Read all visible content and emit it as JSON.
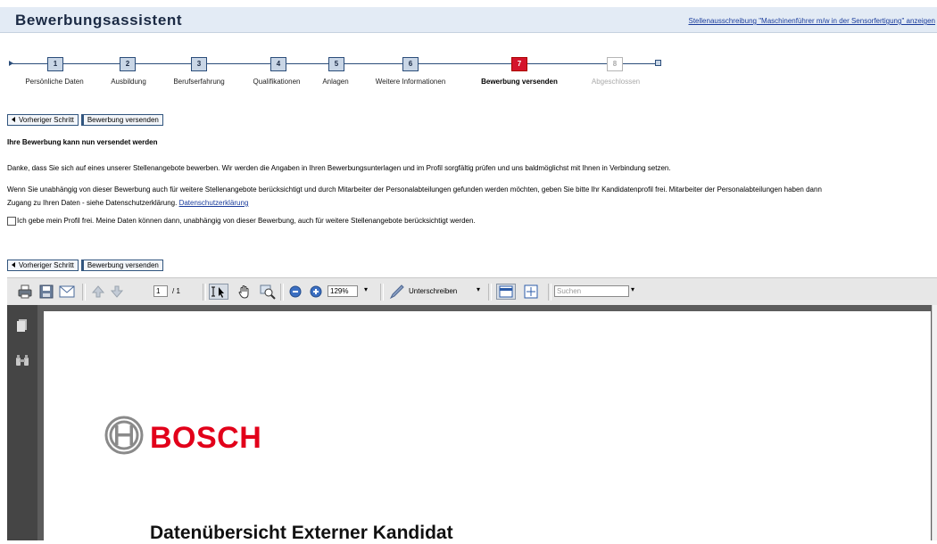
{
  "header": {
    "title": "Bewerbungsassistent",
    "job_link": "Stellenausschreibung \"Maschinenführer m/w in der Sensorfertigung\" anzeigen"
  },
  "roadmap": {
    "steps": [
      {
        "number": "1",
        "label": "Persönliche Daten",
        "state": "done"
      },
      {
        "number": "2",
        "label": "Ausbildung",
        "state": "done"
      },
      {
        "number": "3",
        "label": "Berufserfahrung",
        "state": "done"
      },
      {
        "number": "4",
        "label": "Qualifikationen",
        "state": "done"
      },
      {
        "number": "5",
        "label": "Anlagen",
        "state": "done"
      },
      {
        "number": "6",
        "label": "Weitere Informationen",
        "state": "done"
      },
      {
        "number": "7",
        "label": "Bewerbung versenden",
        "state": "active"
      },
      {
        "number": "8",
        "label": "Abgeschlossen",
        "state": "disabled"
      }
    ]
  },
  "buttons": {
    "previous": "Vorheriger Schritt",
    "send": "Bewerbung versenden"
  },
  "content": {
    "section_title": "Ihre Bewerbung kann nun versendet werden",
    "thanks": "Danke, dass Sie sich auf eines unserer Stellenangebote bewerben. Wir werden die Angaben in Ihren Bewerbungsunterlagen und im Profil sorgfältig prüfen und uns baldmöglichst mit Ihnen in Verbindung setzen.",
    "profile_line1": "Wenn Sie unabhängig von dieser Bewerbung auch für weitere Stellenangebote berücksichtigt und durch Mitarbeiter der Personalabteilungen gefunden werden möchten, geben Sie bitte Ihr Kandidatenprofil frei. Mitarbeiter der Personalabteilungen haben dann",
    "profile_line2": "Zugang zu Ihren Daten - siehe Datenschutzerklärung.",
    "privacy_link": "Datenschutzerklärung",
    "consent_label": "Ich gebe mein Profil frei. Meine Daten können dann, unabhängig von dieser Bewerbung, auch für weitere Stellenangebote berücksichtigt werden.",
    "consent_checked": false
  },
  "pdf_viewer": {
    "page_current": "1",
    "page_total": "/ 1",
    "zoom": "129%",
    "sign_label": "Unterschreiben",
    "search_placeholder": "Suchen",
    "document": {
      "brand": "BOSCH",
      "title": "Datenübersicht Externer Kandidat"
    }
  },
  "colors": {
    "active_step": "#d4142c",
    "brand_red": "#e2001a",
    "link": "#1a3c9c"
  }
}
